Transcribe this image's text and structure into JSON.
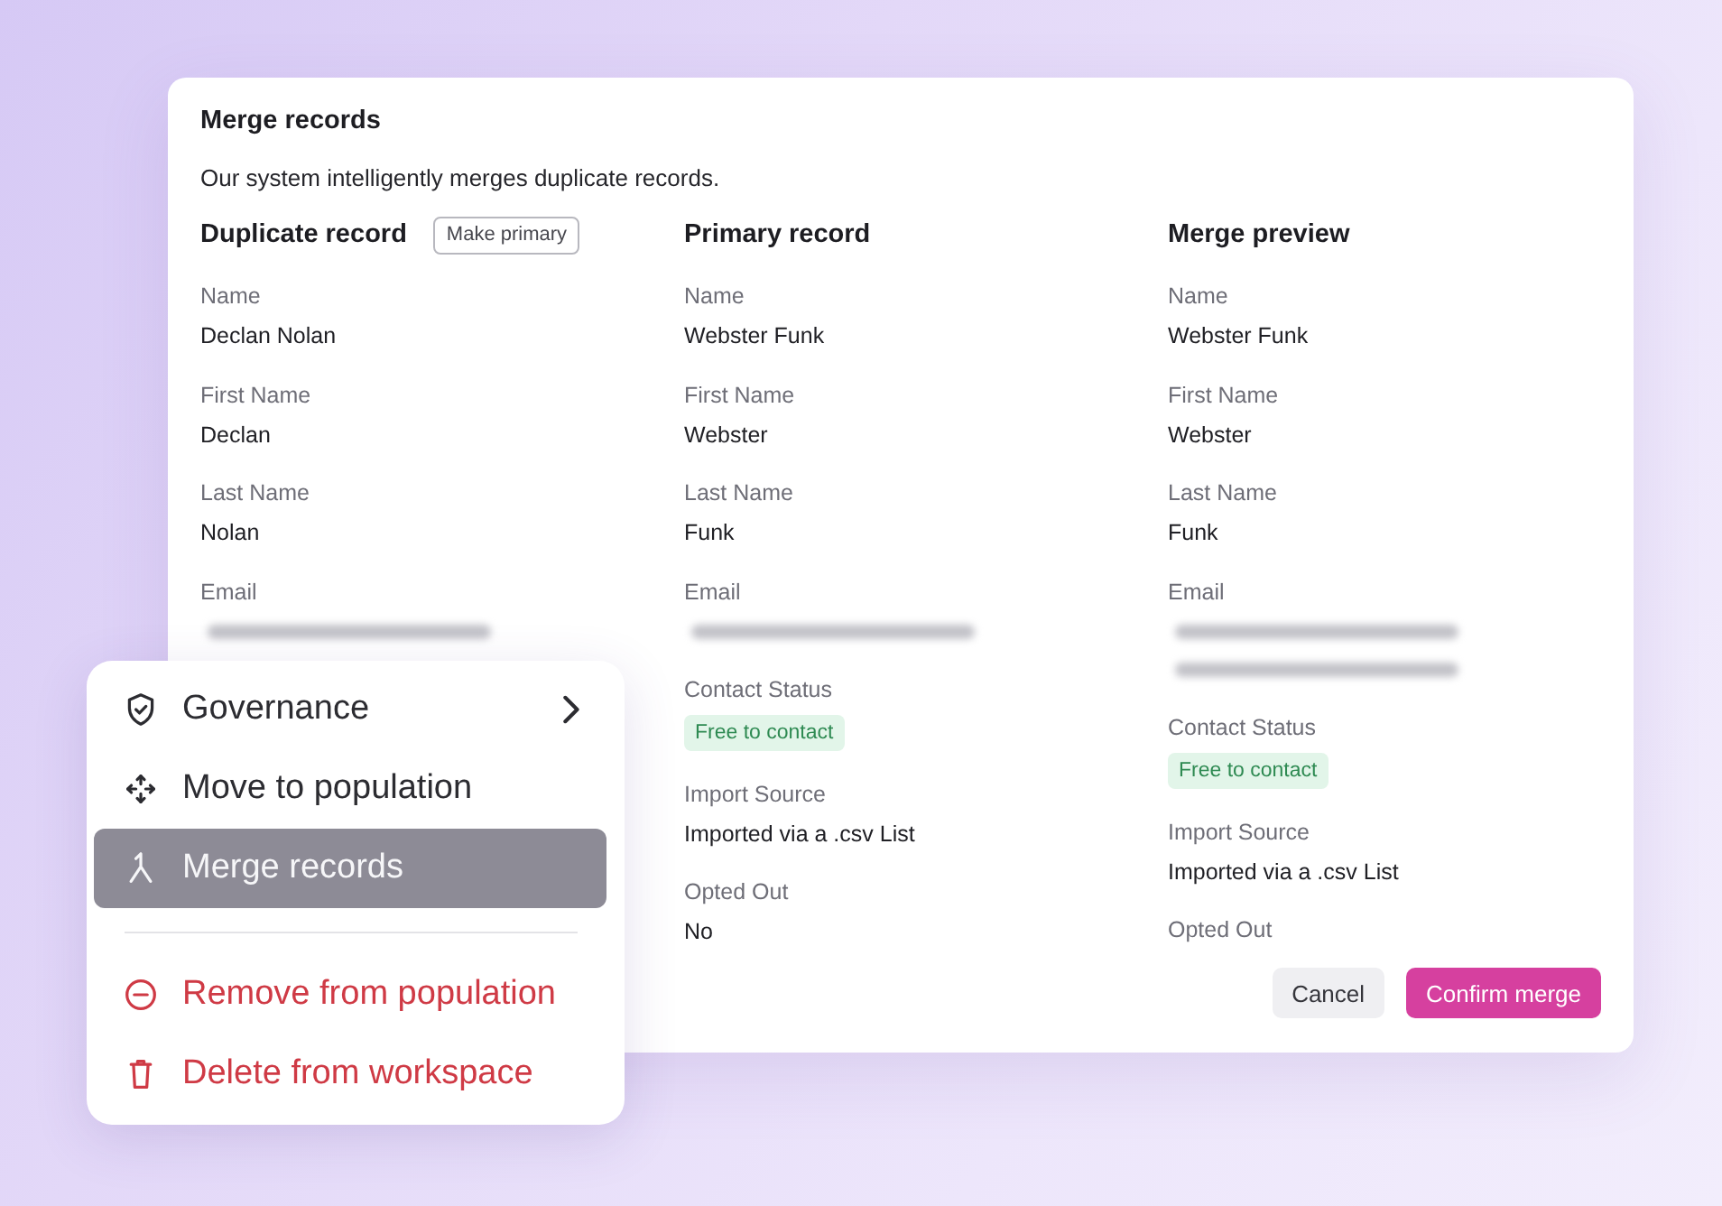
{
  "dialog": {
    "title": "Merge records",
    "description": "Our system intelligently merges duplicate records.",
    "columns": [
      {
        "heading": "Duplicate record",
        "action": "Make primary",
        "fields": [
          {
            "label": "Name",
            "values": [
              {
                "kind": "text",
                "text": "Declan Nolan"
              }
            ]
          },
          {
            "label": "First Name",
            "values": [
              {
                "kind": "text",
                "text": "Declan"
              }
            ]
          },
          {
            "label": "Last Name",
            "values": [
              {
                "kind": "text",
                "text": "Nolan"
              }
            ]
          },
          {
            "label": "Email",
            "values": [
              {
                "kind": "blurred"
              }
            ]
          }
        ]
      },
      {
        "heading": "Primary record",
        "fields": [
          {
            "label": "Name",
            "values": [
              {
                "kind": "text",
                "text": "Webster Funk"
              }
            ]
          },
          {
            "label": "First Name",
            "values": [
              {
                "kind": "text",
                "text": "Webster"
              }
            ]
          },
          {
            "label": "Last Name",
            "values": [
              {
                "kind": "text",
                "text": "Funk"
              }
            ]
          },
          {
            "label": "Email",
            "values": [
              {
                "kind": "blurred"
              }
            ]
          },
          {
            "label": "Contact Status",
            "values": [
              {
                "kind": "badge",
                "text": "Free to contact"
              }
            ]
          },
          {
            "label": "Import Source",
            "values": [
              {
                "kind": "text",
                "text": "Imported via a .csv List"
              }
            ]
          },
          {
            "label": "Opted Out",
            "values": [
              {
                "kind": "text",
                "text": "No"
              }
            ]
          }
        ]
      },
      {
        "heading": "Merge preview",
        "fields": [
          {
            "label": "Name",
            "values": [
              {
                "kind": "text",
                "text": "Webster Funk"
              }
            ]
          },
          {
            "label": "First Name",
            "values": [
              {
                "kind": "text",
                "text": "Webster"
              }
            ]
          },
          {
            "label": "Last Name",
            "values": [
              {
                "kind": "text",
                "text": "Funk"
              }
            ]
          },
          {
            "label": "Email",
            "values": [
              {
                "kind": "blurred"
              },
              {
                "kind": "blurred"
              }
            ]
          },
          {
            "label": "Contact Status",
            "values": [
              {
                "kind": "badge",
                "text": "Free to contact"
              }
            ]
          },
          {
            "label": "Import Source",
            "values": [
              {
                "kind": "text",
                "text": "Imported via a .csv List"
              }
            ]
          },
          {
            "label": "Opted Out"
          }
        ]
      }
    ],
    "buttons": [
      {
        "label": "Cancel",
        "kind": "secondary"
      },
      {
        "label": "Confirm merge",
        "kind": "primary"
      }
    ]
  },
  "context_menu": {
    "sections": [
      {
        "items": [
          {
            "label": "Governance",
            "kind": "normal",
            "selected": false,
            "submenu": true
          },
          {
            "label": "Move to population",
            "kind": "normal",
            "selected": false,
            "submenu": false
          },
          {
            "label": "Merge records",
            "kind": "normal",
            "selected": true,
            "submenu": false
          }
        ]
      },
      {
        "items": [
          {
            "label": "Remove from population",
            "kind": "danger",
            "selected": false,
            "submenu": false
          },
          {
            "label": "Delete from workspace",
            "kind": "danger",
            "selected": false,
            "submenu": false
          }
        ]
      }
    ]
  }
}
